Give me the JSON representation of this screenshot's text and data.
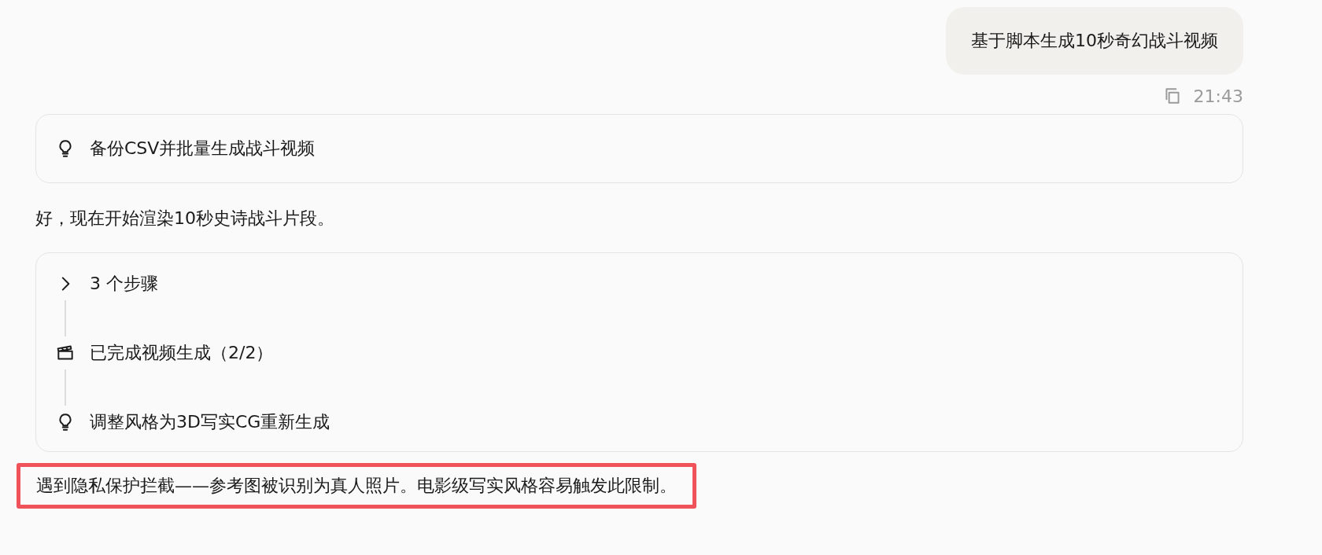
{
  "user_message": {
    "text": "基于脚本生成10秒奇幻战斗视频",
    "time": "21:43"
  },
  "idea_card": {
    "text": "备份CSV并批量生成战斗视频"
  },
  "reply": {
    "text": "好，现在开始渲染10秒史诗战斗片段。"
  },
  "steps_card": {
    "summary": {
      "text": "3 个步骤",
      "expanded": false
    },
    "steps": [
      {
        "kind": "video",
        "text": "已完成视频生成（2/2）"
      },
      {
        "kind": "idea",
        "text": "调整风格为3D写实CG重新生成"
      }
    ]
  },
  "note": {
    "text": "遇到隐私保护拦截——参考图被识别为真人照片。电影级写实风格容易触发此限制。",
    "highlighted": true
  }
}
